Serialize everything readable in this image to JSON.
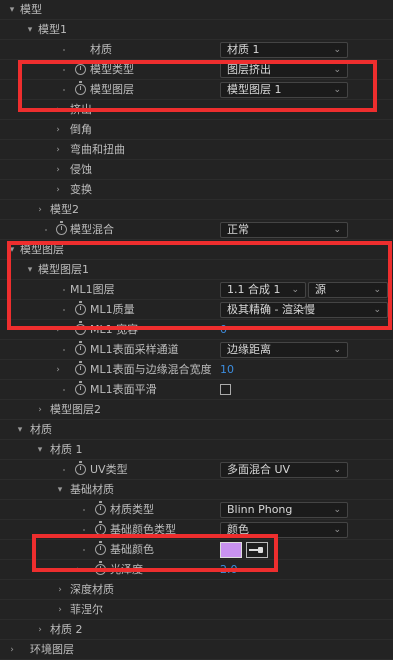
{
  "tree": {
    "model": "模型",
    "model1": "模型1",
    "material": "材质",
    "material_value": "材质 1",
    "model_type": "模型类型",
    "model_type_value": "图层挤出",
    "model_layer": "模型图层",
    "model_layer_value": "模型图层 1",
    "extrude": "挤出",
    "bevel": "倒角",
    "bend_twist": "弯曲和扭曲",
    "erode": "侵蚀",
    "transform": "变换",
    "model2": "模型2",
    "model_blend": "模型混合",
    "model_blend_value": "正常",
    "model_layers_group": "模型图层",
    "model_layer1": "模型图层1",
    "ml1_layer": "ML1图层",
    "ml1_layer_value": "1.1 合成 1",
    "ml1_layer_source": "源",
    "ml1_quality": "ML1质量",
    "ml1_quality_value": "极其精确 - 渲染慢",
    "ml1_tolerance": "ML1 宽容",
    "ml1_tolerance_value": "0",
    "ml1_surface_sampling": "ML1表面采样通道",
    "ml1_surface_sampling_value": "边缘距离",
    "ml1_edge_blend": "ML1表面与边缘混合宽度",
    "ml1_edge_blend_value": "10",
    "ml1_smooth": "ML1表面平滑",
    "model_layer2": "模型图层2",
    "materials_group": "材质",
    "material1": "材质 1",
    "uv_type": "UV类型",
    "uv_type_value": "多面混合 UV",
    "base_material": "基础材质",
    "material_type": "材质类型",
    "material_type_value": "Blinn Phong",
    "base_color_type": "基础颜色类型",
    "base_color_type_value": "颜色",
    "base_color": "基础颜色",
    "base_color_hex": "#c992f0",
    "gloss": "光泽度",
    "gloss_value": "2.0",
    "depth_material": "深度材质",
    "fresnel": "菲涅尔",
    "material2": "材质 2",
    "env_layer": "环境图层"
  },
  "icons": {
    "expanded": "chevron-down-icon",
    "collapsed": "chevron-right-icon",
    "stopwatch": "stopwatch-icon",
    "eyedropper": "eyedropper-icon"
  },
  "colors": {
    "highlight": "#ee2e2e",
    "value_blue": "#3c8ddf",
    "background": "#232323"
  }
}
